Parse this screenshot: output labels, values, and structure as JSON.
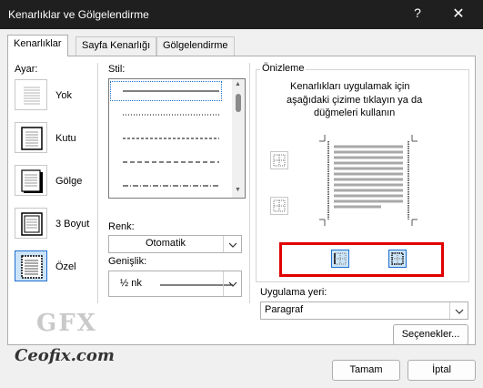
{
  "window": {
    "title": "Kenarlıklar ve Gölgelendirme",
    "help_glyph": "?",
    "close_glyph": "✕"
  },
  "tabs": [
    {
      "label": "Kenarlıklar",
      "active": true
    },
    {
      "label": "Sayfa Kenarlığı",
      "active": false
    },
    {
      "label": "Gölgelendirme",
      "active": false
    }
  ],
  "settings": {
    "label": "Ayar:",
    "items": [
      {
        "label": "Yok",
        "icon": "none-setting-icon",
        "selected": false
      },
      {
        "label": "Kutu",
        "icon": "box-setting-icon",
        "selected": false
      },
      {
        "label": "Gölge",
        "icon": "shadow-setting-icon",
        "selected": false
      },
      {
        "label": "3 Boyut",
        "icon": "3d-setting-icon",
        "selected": false
      },
      {
        "label": "Özel",
        "icon": "custom-setting-icon",
        "selected": true
      }
    ]
  },
  "style": {
    "label": "Stil:",
    "options": [
      "solid",
      "dotted",
      "dashed-small",
      "dashed",
      "dash-dot"
    ]
  },
  "color": {
    "label": "Renk:",
    "value": "Otomatik"
  },
  "width": {
    "label": "Genişlik:",
    "value": "½ nk"
  },
  "preview": {
    "label": "Önizleme",
    "instruction_line1": "Kenarlıkları uygulamak için",
    "instruction_line2": "aşağıdaki çizime tıklayın ya da",
    "instruction_line3": "düğmeleri kullanın"
  },
  "apply_to": {
    "label": "Uygulama yeri:",
    "value": "Paragraf"
  },
  "buttons": {
    "options": "Seçenekler...",
    "ok": "Tamam",
    "cancel": "İptal"
  },
  "watermark": {
    "logo_text": "GFX",
    "site_text": "Ceofix.com"
  },
  "colors": {
    "accent": "#1e6fd0",
    "highlight": "#e00000",
    "titlebar": "#1f1f1f"
  }
}
